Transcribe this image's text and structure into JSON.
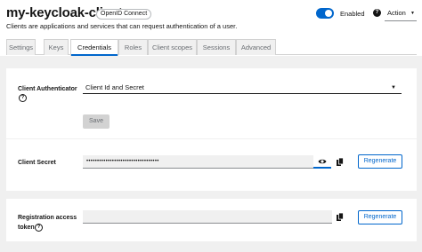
{
  "header": {
    "title": "my-keycloak-client",
    "badge": "OpenID Connect",
    "subtitle": "Clients are applications and services that can request authentication of a user.",
    "enabled_label": "Enabled",
    "enabled": true,
    "help_icon": "?",
    "action_label": "Action"
  },
  "tabs": [
    {
      "label": "Settings",
      "active": false
    },
    {
      "label": "Keys",
      "active": false
    },
    {
      "label": "Credentials",
      "active": true
    },
    {
      "label": "Roles",
      "active": false
    },
    {
      "label": "Client scopes",
      "active": false
    },
    {
      "label": "Sessions",
      "active": false
    },
    {
      "label": "Advanced",
      "active": false
    }
  ],
  "credentials": {
    "authenticator_label": "Client Authenticator",
    "authenticator_value": "Client Id and Secret",
    "save_label": "Save",
    "secret_label": "Client Secret",
    "secret_value": "••••••••••••••••••••••••••••••••••",
    "regenerate_label": "Regenerate",
    "registration_label_line1": "Registration access",
    "registration_label_line2": "token",
    "registration_value": "",
    "regenerate2_label": "Regenerate",
    "help_icon": "?"
  },
  "colors": {
    "accent": "#0066cc",
    "background": "#f0f0f0"
  }
}
